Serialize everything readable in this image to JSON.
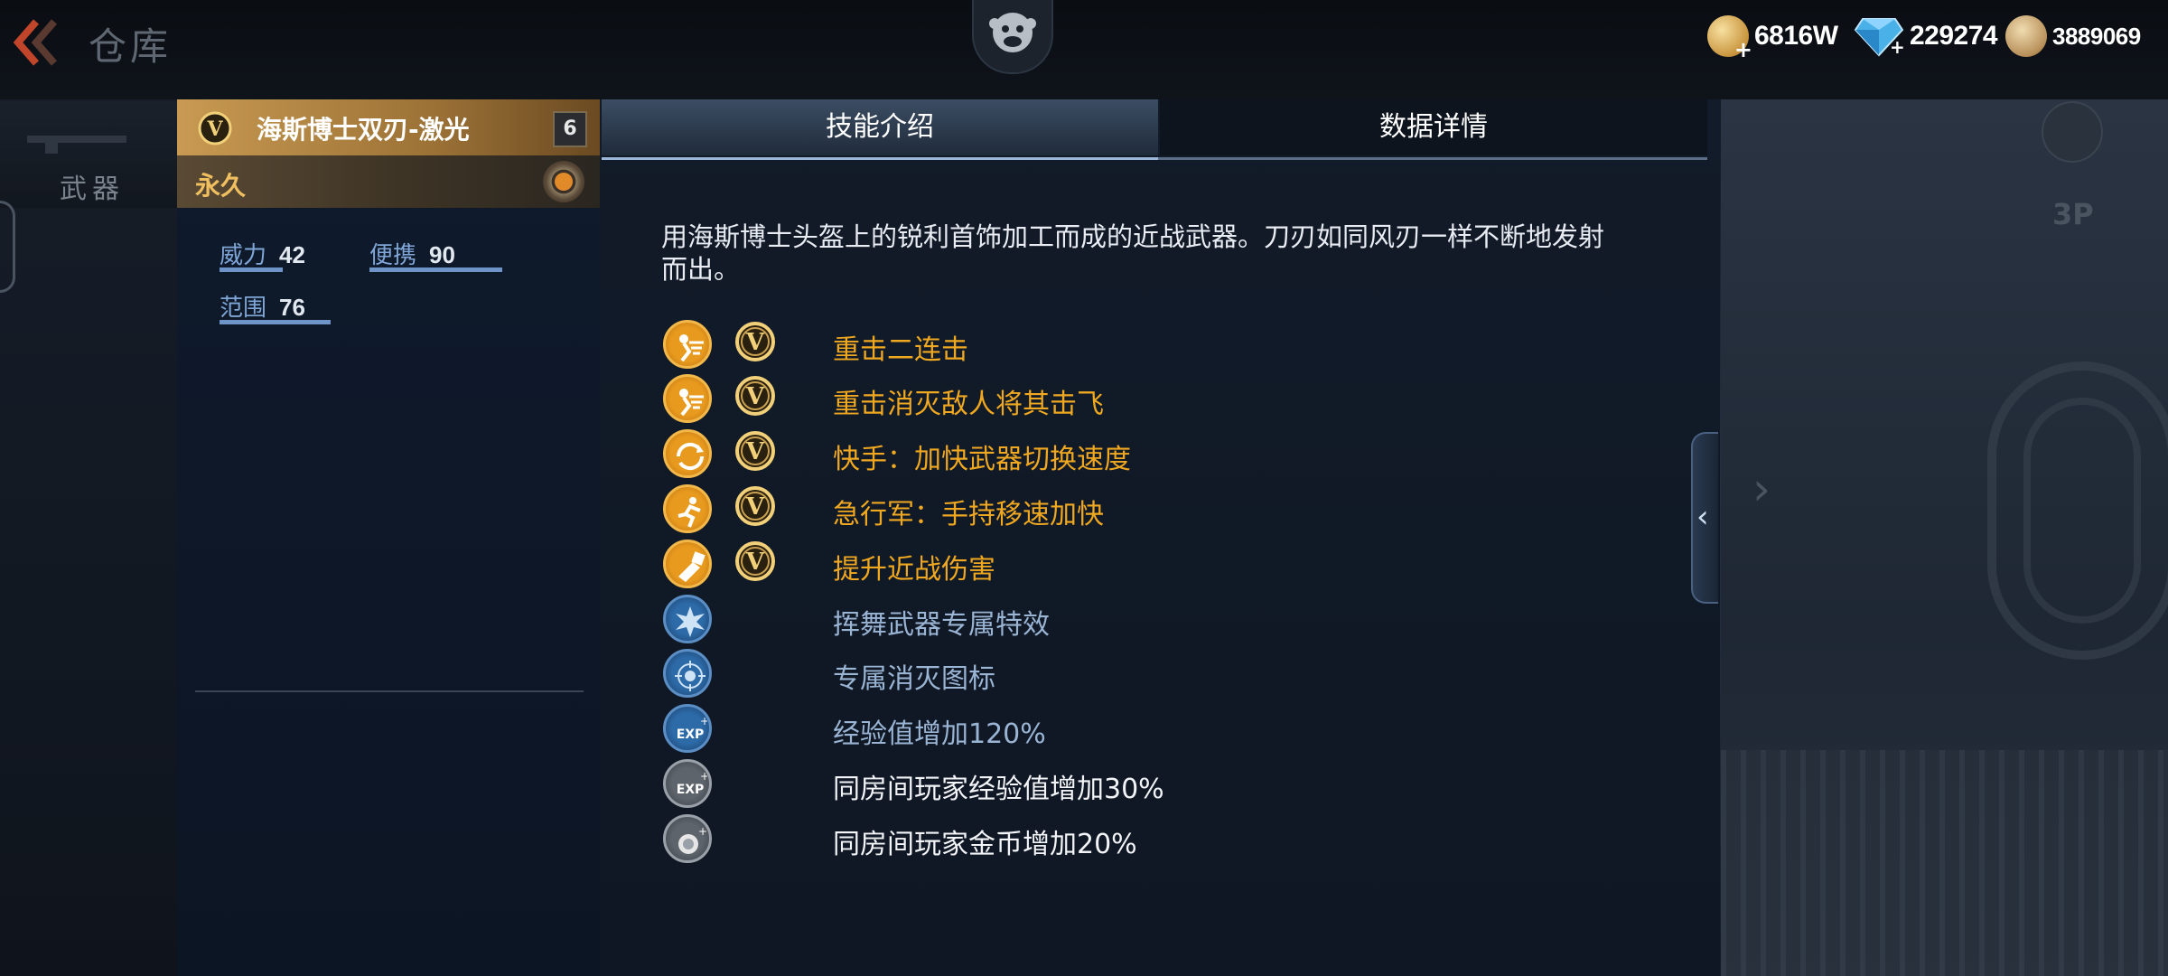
{
  "topbar": {
    "title": "仓库",
    "currencies": [
      {
        "icon": "gold-coin-icon",
        "value": "6816W"
      },
      {
        "icon": "diamond-icon",
        "value": "229274"
      },
      {
        "icon": "token-icon",
        "value": "3889069"
      }
    ]
  },
  "sidebar": {
    "tab_label": "武器"
  },
  "background": {
    "view_label": "3P"
  },
  "weapon": {
    "name": "海斯博士双刃-激光",
    "level": "6",
    "duration": "永久",
    "stats": [
      {
        "label": "威力",
        "value": "42"
      },
      {
        "label": "便携",
        "value": "90"
      },
      {
        "label": "范围",
        "value": "76"
      }
    ]
  },
  "tabs": {
    "active": "技能介绍",
    "inactive": "数据详情"
  },
  "description": "用海斯博士头盔上的锐利首饰加工而成的近战武器。刀刃如同风刃一样不断地发射而出。",
  "perks": [
    {
      "icon": "heavy-attack-icon",
      "style": "gold",
      "vip": true,
      "text": "重击二连击"
    },
    {
      "icon": "heavy-attack-icon",
      "style": "gold",
      "vip": true,
      "text": "重击消灭敌人将其击飞"
    },
    {
      "icon": "weapon-switch-icon",
      "style": "gold",
      "vip": true,
      "text": "快手：加快武器切换速度"
    },
    {
      "icon": "running-icon",
      "style": "gold",
      "vip": true,
      "text": "急行军：手持移速加快"
    },
    {
      "icon": "melee-damage-icon",
      "style": "gold",
      "vip": true,
      "text": "提升近战伤害"
    },
    {
      "icon": "burst-effect-icon",
      "style": "blue",
      "vip": false,
      "text": "挥舞武器专属特效"
    },
    {
      "icon": "kill-icon",
      "style": "blue",
      "vip": false,
      "text": "专属消灭图标"
    },
    {
      "icon": "exp-icon",
      "style": "blue",
      "vip": false,
      "text": "经验值增加120%"
    },
    {
      "icon": "exp-icon",
      "style": "grey",
      "vip": false,
      "text": "同房间玩家经验值增加30%"
    },
    {
      "icon": "coin-bonus-icon",
      "style": "grey",
      "vip": false,
      "text": "同房间玩家金币增加20%"
    }
  ],
  "colors": {
    "accent_gold": "#f0a820",
    "perk_blue": "#9ab4d4",
    "stat_blue": "#7fa6d6"
  }
}
